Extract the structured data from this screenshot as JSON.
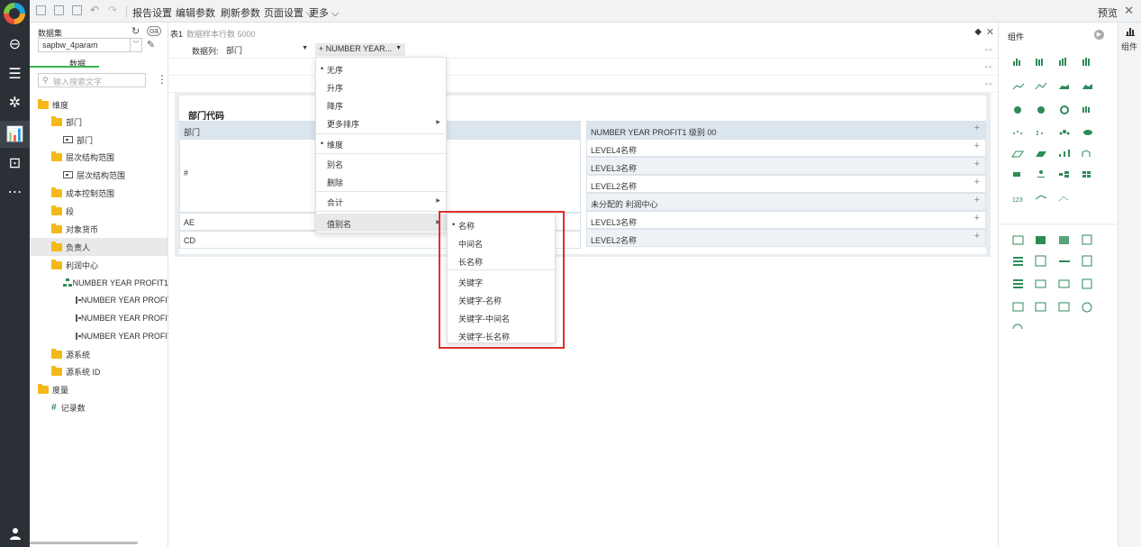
{
  "toolbar": {
    "report_settings": "报告设置",
    "edit_params": "编辑参数",
    "refresh_params": "刷新参数",
    "page_settings": "页面设置 ⌵",
    "more": "更多 ⌵",
    "preview": "预览",
    "close": "✕"
  },
  "data_panel": {
    "dataset_label": "数据集",
    "dataset_value": "sapbw_4param",
    "tab_data": "数据",
    "search_placeholder": "输入搜索文字",
    "tree": [
      {
        "label": "维度",
        "kind": "folder"
      },
      {
        "label": "部门",
        "kind": "folder"
      },
      {
        "label": "部门",
        "kind": "field"
      },
      {
        "label": "层次结构范围",
        "kind": "folder"
      },
      {
        "label": "层次结构范围",
        "kind": "field"
      },
      {
        "label": "成本控制范围",
        "kind": "folder"
      },
      {
        "label": "段",
        "kind": "folder"
      },
      {
        "label": "对象货币",
        "kind": "folder"
      },
      {
        "label": "负责人",
        "kind": "folder"
      },
      {
        "label": "利润中心",
        "kind": "folder"
      },
      {
        "label": "NUMBER YEAR PROFIT1",
        "kind": "hierarchy"
      },
      {
        "label": "NUMBER YEAR PROFIT",
        "kind": "field"
      },
      {
        "label": "NUMBER YEAR PROFIT",
        "kind": "field"
      },
      {
        "label": "NUMBER YEAR PROFIT",
        "kind": "field"
      },
      {
        "label": "源系统",
        "kind": "folder"
      },
      {
        "label": "源系统 ID",
        "kind": "folder"
      },
      {
        "label": "度量",
        "kind": "folder"
      },
      {
        "label": "记录数",
        "kind": "measure"
      }
    ]
  },
  "main": {
    "table_label": "表1",
    "sample_rows": "数据样本行数 5000",
    "data_column_label": "数据列:",
    "field1": "部门",
    "field2": "+ NUMBER YEAR...",
    "table_title": "部门代码",
    "left_cells": [
      "部门",
      "#",
      "AE",
      "CD"
    ],
    "right_cells": [
      "NUMBER YEAR PROFIT1 级别 00",
      "LEVEL4名称",
      "LEVEL3名称",
      "LEVEL2名称",
      "未分配的 利润中心",
      "LEVEL3名称",
      "LEVEL2名称"
    ],
    "plus": "+"
  },
  "context_menu": {
    "items": [
      "无序",
      "升序",
      "降序",
      "更多排序",
      "维度",
      "别名",
      "删除",
      "合计",
      "值别名"
    ]
  },
  "submenu": {
    "items": [
      "名称",
      "中间名",
      "长名称",
      "关键字",
      "关键字-名称",
      "关键字-中间名",
      "关键字-长名称"
    ]
  },
  "right_panel": {
    "title": "组件",
    "strip_label": "组件"
  },
  "colors": {
    "accent_green": "#39b54a",
    "highlight_red": "#e0302d",
    "rail_dark": "#2b3036"
  }
}
